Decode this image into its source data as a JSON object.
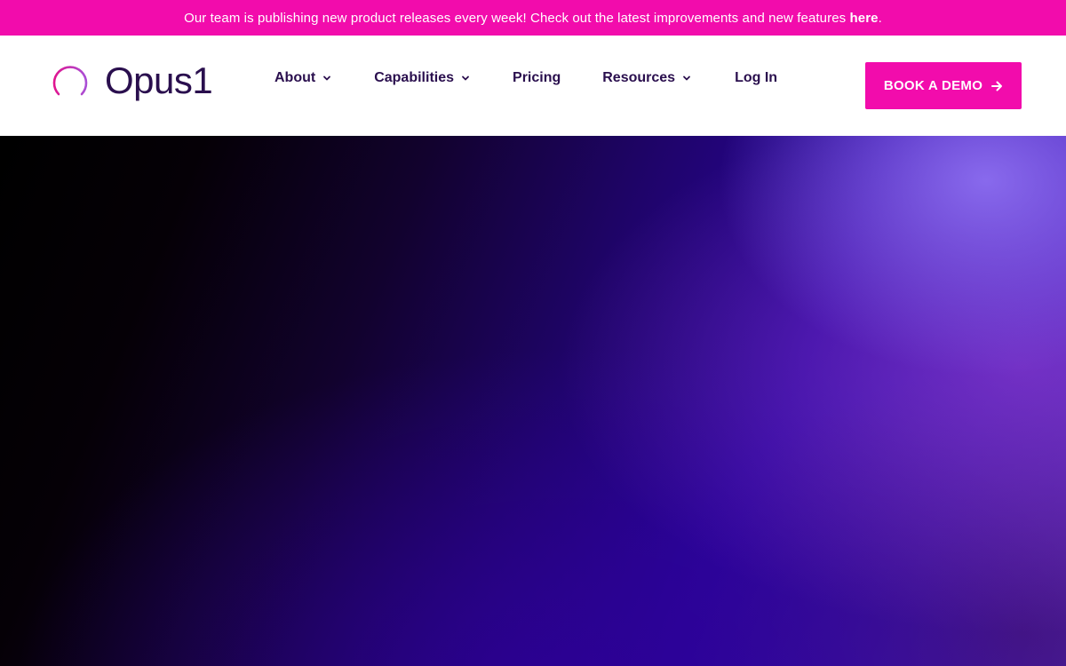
{
  "announcement": {
    "text": "Our team is publishing new product releases every week! Check out the latest improvements and new features",
    "link_label": "here",
    "suffix": "."
  },
  "brand": {
    "name": "Opus1",
    "logo_icon": "soundwave-circle-icon"
  },
  "nav": {
    "items": [
      {
        "label": "About",
        "has_dropdown": true
      },
      {
        "label": "Capabilities",
        "has_dropdown": true
      },
      {
        "label": "Pricing",
        "has_dropdown": false
      },
      {
        "label": "Resources",
        "has_dropdown": true
      },
      {
        "label": "Log In",
        "has_dropdown": false
      }
    ]
  },
  "cta": {
    "label": "BOOK A DEMO",
    "icon": "arrow-right-icon"
  },
  "colors": {
    "accent_pink": "#f20cac",
    "brand_dark": "#2a0f4e",
    "hero_purple": "#2a05a0"
  }
}
